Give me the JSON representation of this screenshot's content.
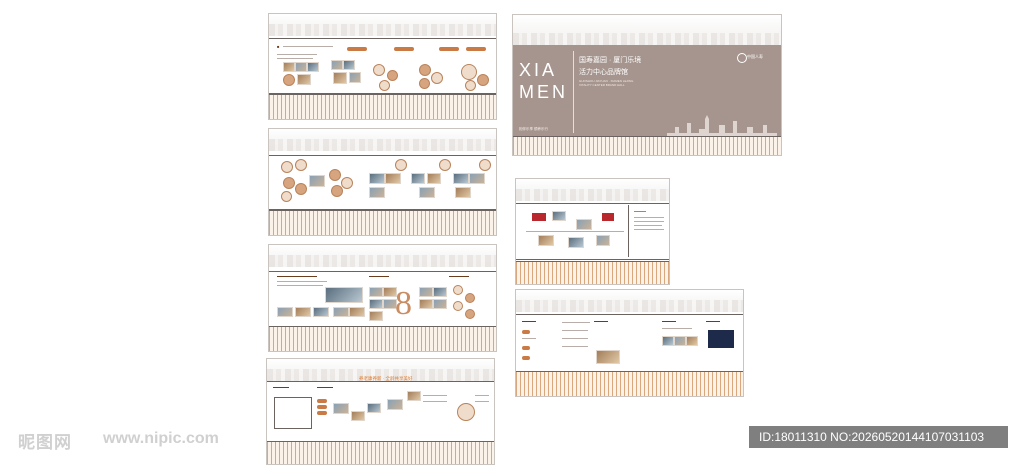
{
  "hero": {
    "xia": "XIA",
    "men": "MEN",
    "title_line1": "国寿嘉园 · 厦门乐境",
    "title_line2": "活力中心品牌馆",
    "subtitle_line1": "GUOSHOU JIAYUAN · XIAMEN LEJING",
    "subtitle_line2": "VITALITY CENTER BRAND HALL",
    "slogan": "相伴乐享    颐养乐行",
    "logo_text": "中国人寿"
  },
  "panel4": {
    "banner": "养老康养新 · 全龄共享美好"
  },
  "watermark": {
    "brand": "昵图网",
    "url": "www.nipic.com"
  },
  "id_text": "ID:18011310 NO:20260520144107031103",
  "colors": {
    "accent": "#c97a45",
    "hero_bg": "#a6958e",
    "stripe": "#d9a77b"
  }
}
